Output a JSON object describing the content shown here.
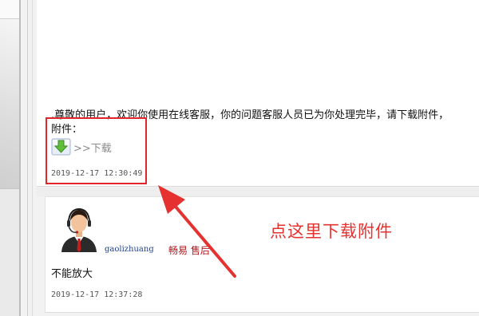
{
  "messages": [
    {
      "text_line1": ".尊敬的用户，欢迎你使用在线客服，你的问题客服人员已为你处理完毕，请下载附件，",
      "text_line2": "附件：",
      "download_label": ">>下载",
      "time": "2019-12-17 12:30:49"
    },
    {
      "username": "gaolizhuang",
      "org": "畅易 售后",
      "text": "不能放大",
      "time": "2019-12-17 12:37:28"
    }
  ],
  "annotation": {
    "text": "点这里下载附件",
    "color": "#e5312f"
  },
  "icons": {
    "download": "download-arrow-icon",
    "avatar": "support-agent-headset-avatar"
  }
}
